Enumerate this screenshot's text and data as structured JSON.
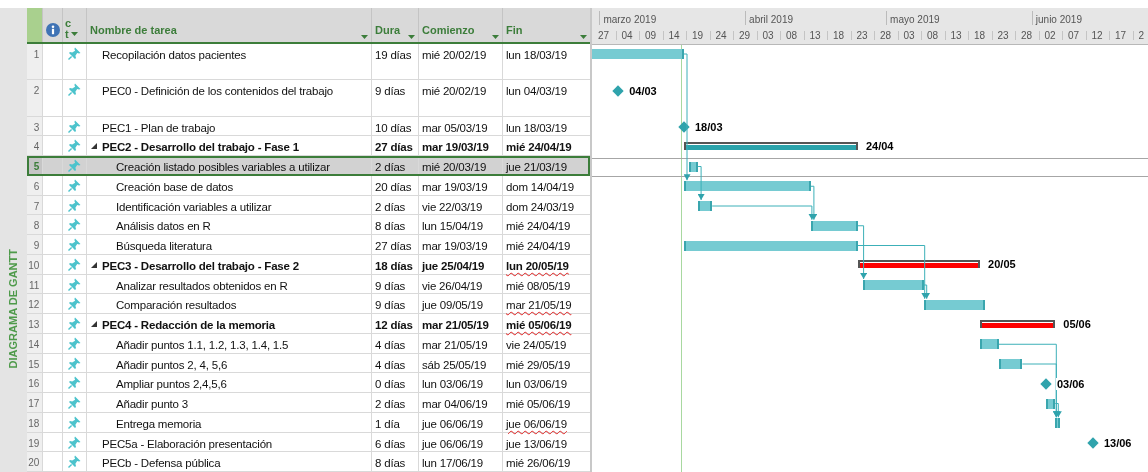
{
  "view_label": "DIAGRAMA DE GANTT",
  "columns": {
    "mode": [
      "c",
      "t"
    ],
    "name": "Nombre de tarea",
    "duration": "Dura",
    "start": "Comienzo",
    "finish": "Fin"
  },
  "timescale": {
    "months": [
      "marzo 2019",
      "abril 2019",
      "mayo 2019",
      "junio 2019"
    ],
    "days": [
      "27",
      "04",
      "09",
      "14",
      "19",
      "24",
      "29",
      "03",
      "08",
      "13",
      "18",
      "23",
      "28",
      "03",
      "08",
      "13",
      "18",
      "23",
      "28",
      "02",
      "07",
      "12",
      "17",
      "2"
    ]
  },
  "tasks": [
    {
      "id": "1",
      "kind": "task",
      "name": "Recopilación datos pacientes",
      "duration": "19 días",
      "start": "mié 20/02/19",
      "finish": "lun 18/03/19",
      "selected": false,
      "flagged": false,
      "bar": {
        "kind": "task"
      }
    },
    {
      "id": "2",
      "kind": "task",
      "name": "PEC0 - Definición de los contenidos del trabajo",
      "duration": "9 días",
      "start": "mié 20/02/19",
      "finish": "lun 04/03/19",
      "selected": false,
      "flagged": false,
      "bar": {
        "kind": "milestone",
        "label": "04/03"
      }
    },
    {
      "id": "3",
      "kind": "task",
      "name": "PEC1 - Plan de trabajo",
      "duration": "10 días",
      "start": "mar 05/03/19",
      "finish": "lun 18/03/19",
      "selected": false,
      "flagged": false,
      "bar": {
        "kind": "milestone",
        "label": "18/03"
      }
    },
    {
      "id": "4",
      "kind": "summary",
      "expanded": true,
      "name": "PEC2 - Desarrollo del trabajo - Fase 1",
      "duration": "27 días",
      "start": "mar 19/03/19",
      "finish": "mié 24/04/19",
      "selected": false,
      "flagged": false,
      "bar": {
        "kind": "summary",
        "color": "#2aa3ab",
        "label": "24/04"
      },
      "children": [
        {
          "id": "5",
          "kind": "task",
          "name": "Creación listado posibles variables a utilizar",
          "duration": "2 días",
          "start": "mié 20/03/19",
          "finish": "jue 21/03/19",
          "selected": true,
          "flagged": false,
          "bar": {
            "kind": "task"
          }
        },
        {
          "id": "6",
          "kind": "task",
          "name": "Creación base de datos",
          "duration": "20 días",
          "start": "mar 19/03/19",
          "finish": "dom 14/04/19",
          "selected": false,
          "flagged": false,
          "bar": {
            "kind": "task"
          }
        },
        {
          "id": "7",
          "kind": "task",
          "name": "Identificación variables a utilizar",
          "duration": "2 días",
          "start": "vie 22/03/19",
          "finish": "dom 24/03/19",
          "selected": false,
          "flagged": false,
          "bar": {
            "kind": "task"
          }
        },
        {
          "id": "8",
          "kind": "task",
          "name": "Análisis datos en R",
          "duration": "8 días",
          "start": "lun 15/04/19",
          "finish": "mié 24/04/19",
          "selected": false,
          "flagged": false,
          "bar": {
            "kind": "task"
          }
        },
        {
          "id": "9",
          "kind": "task",
          "name": "Búsqueda literatura",
          "duration": "27 días",
          "start": "mar 19/03/19",
          "finish": "mié 24/04/19",
          "selected": false,
          "flagged": false,
          "bar": {
            "kind": "task"
          }
        }
      ]
    },
    {
      "id": "10",
      "kind": "summary",
      "expanded": true,
      "name": "PEC3 - Desarrollo del trabajo - Fase 2",
      "duration": "18 días",
      "start": "jue 25/04/19",
      "finish": "lun 20/05/19",
      "selected": false,
      "flagged": true,
      "bar": {
        "kind": "summary",
        "color": "#ff0000",
        "label": "20/05"
      },
      "children": [
        {
          "id": "11",
          "kind": "task",
          "name": "Analizar resultados obtenidos en R",
          "duration": "9 días",
          "start": "vie 26/04/19",
          "finish": "mié 08/05/19",
          "selected": false,
          "flagged": false,
          "bar": {
            "kind": "task"
          }
        },
        {
          "id": "12",
          "kind": "task",
          "name": "Comparación resultados",
          "duration": "9 días",
          "start": "jue 09/05/19",
          "finish": "mar 21/05/19",
          "selected": false,
          "flagged": true,
          "bar": {
            "kind": "task"
          }
        }
      ]
    },
    {
      "id": "13",
      "kind": "summary",
      "expanded": true,
      "name": "PEC4 - Redacción de la memoria",
      "duration": "12 días",
      "start": "mar 21/05/19",
      "finish": "mié 05/06/19",
      "selected": false,
      "flagged": true,
      "bar": {
        "kind": "summary",
        "color": "#ff0000",
        "label": "05/06"
      },
      "children": [
        {
          "id": "14",
          "kind": "task",
          "name": "Añadir puntos 1.1, 1.2, 1.3, 1.4, 1.5",
          "duration": "4 días",
          "start": "mar 21/05/19",
          "finish": "vie 24/05/19",
          "selected": false,
          "flagged": false,
          "bar": {
            "kind": "task"
          }
        },
        {
          "id": "15",
          "kind": "task",
          "name": "Añadir puntos 2, 4, 5,6",
          "duration": "4 días",
          "start": "sáb 25/05/19",
          "finish": "mié 29/05/19",
          "selected": false,
          "flagged": false,
          "bar": {
            "kind": "task"
          }
        },
        {
          "id": "16",
          "kind": "task",
          "name": "Ampliar puntos 2,4,5,6",
          "duration": "0 días",
          "start": "lun 03/06/19",
          "finish": "lun 03/06/19",
          "selected": false,
          "flagged": false,
          "bar": {
            "kind": "milestone",
            "label": "03/06"
          }
        },
        {
          "id": "17",
          "kind": "task",
          "name": "Añadir punto 3",
          "duration": "2 días",
          "start": "mar 04/06/19",
          "finish": "mié 05/06/19",
          "selected": false,
          "flagged": false,
          "bar": {
            "kind": "task"
          }
        },
        {
          "id": "18",
          "kind": "task",
          "name": "Entrega memoria",
          "duration": "1 día",
          "start": "jue 06/06/19",
          "finish": "jue 06/06/19",
          "selected": false,
          "flagged": true,
          "bar": {
            "kind": "task"
          }
        }
      ]
    },
    {
      "id": "19",
      "kind": "task",
      "name": "PEC5a - Elaboración presentación",
      "duration": "6 días",
      "start": "jue 06/06/19",
      "finish": "jue 13/06/19",
      "selected": false,
      "flagged": false,
      "bar": {
        "kind": "milestone",
        "label": "13/06"
      }
    },
    {
      "id": "20",
      "kind": "task",
      "name": "PECb - Defensa pública",
      "duration": "8 días",
      "start": "lun 17/06/19",
      "finish": "mié 26/06/19",
      "selected": false,
      "flagged": false
    }
  ]
}
